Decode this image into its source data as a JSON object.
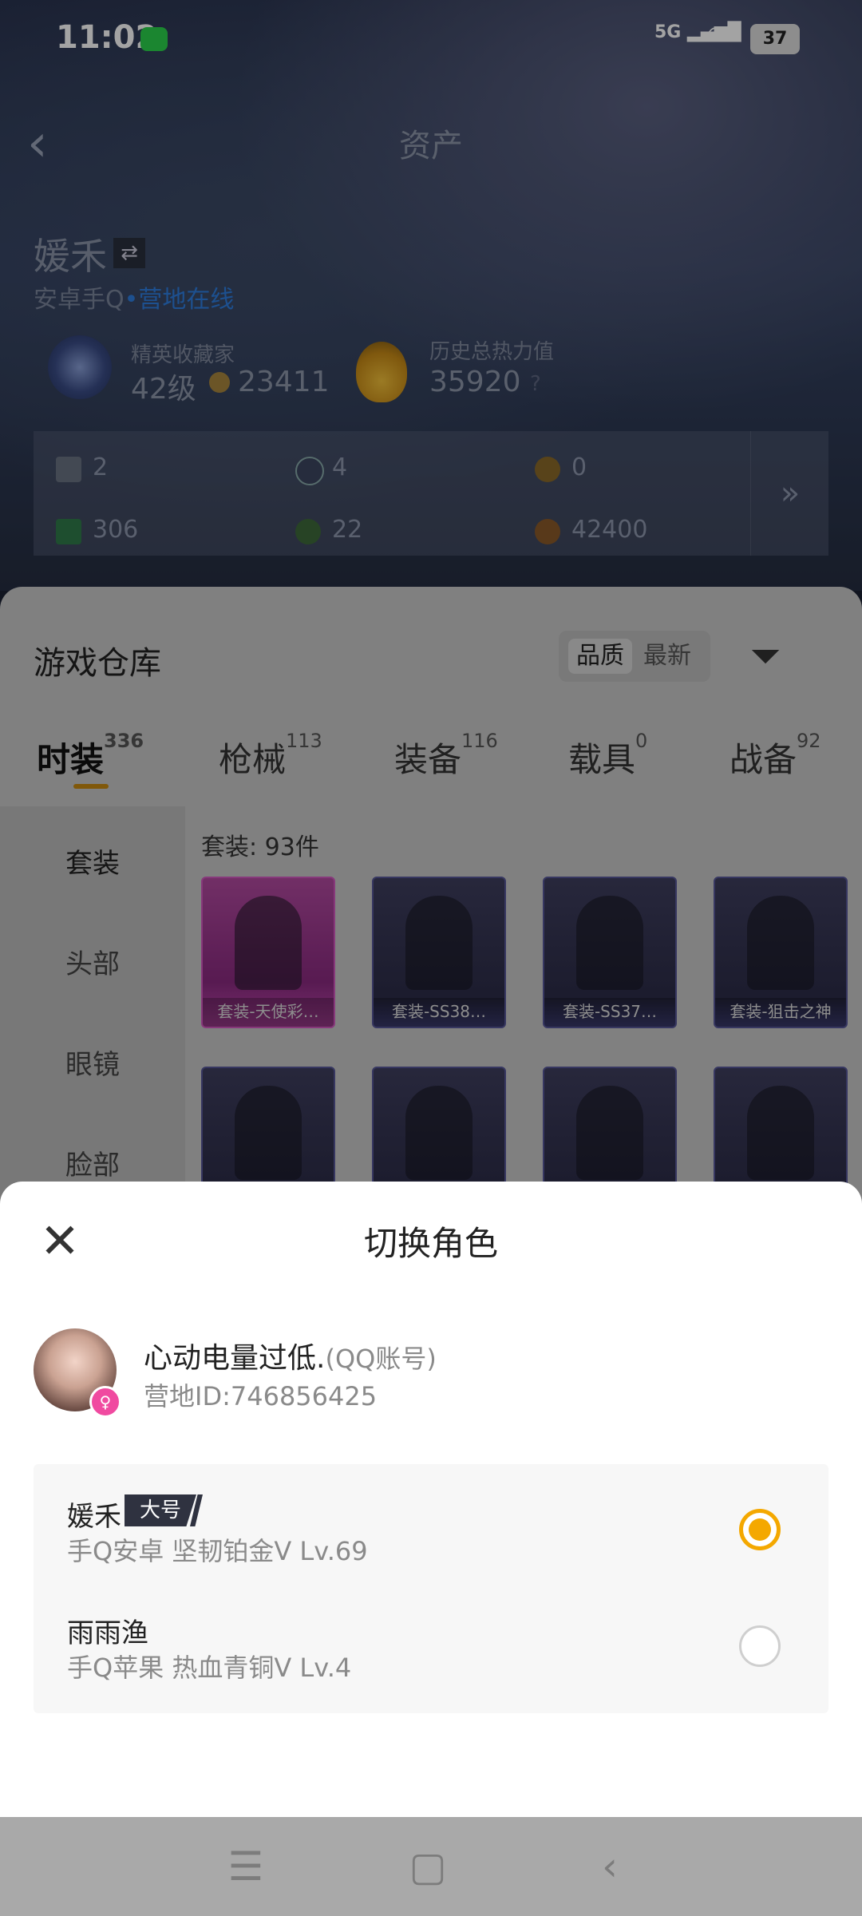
{
  "status_bar": {
    "time": "11:02",
    "network": "5G",
    "battery": "37"
  },
  "header": {
    "title": "资产"
  },
  "player": {
    "name": "媛禾",
    "platform": "安卓手Q",
    "online_status": "营地在线",
    "rank_title": "精英收藏家",
    "level": "42级",
    "coins": "23411",
    "heat_label": "历史总热力值",
    "heat_value": "35920",
    "heat_help": "?"
  },
  "assets": [
    {
      "icon": "card-icon",
      "value": "2"
    },
    {
      "icon": "s-coin-icon",
      "value": "4"
    },
    {
      "icon": "a-coin-icon",
      "value": "0"
    },
    {
      "icon": "ticket-icon",
      "value": "306"
    },
    {
      "icon": "gem-icon",
      "value": "22"
    },
    {
      "icon": "bronze-coin-icon",
      "value": "42400"
    }
  ],
  "warehouse": {
    "title": "游戏仓库",
    "sort": {
      "quality": "品质",
      "newest": "最新"
    },
    "tabs": [
      {
        "label": "时装",
        "count": "336"
      },
      {
        "label": "枪械",
        "count": "113"
      },
      {
        "label": "装备",
        "count": "116"
      },
      {
        "label": "载具",
        "count": "0"
      },
      {
        "label": "战备",
        "count": "92"
      }
    ],
    "side_nav": [
      "套装",
      "头部",
      "眼镜",
      "脸部"
    ],
    "count_label": "套装: 93件",
    "items": [
      {
        "caption": "套装-天使彩…"
      },
      {
        "caption": "套装-SS38…"
      },
      {
        "caption": "套装-SS37…"
      },
      {
        "caption": "套装-狙击之神"
      },
      {
        "caption": ""
      },
      {
        "caption": ""
      },
      {
        "caption": ""
      },
      {
        "caption": ""
      }
    ]
  },
  "sheet": {
    "title": "切换角色",
    "account": {
      "name": "心动电量过低.",
      "type": "(QQ账号)",
      "id": "营地ID:746856425"
    },
    "roles": [
      {
        "name": "媛禾",
        "tag": "大号",
        "info": "手Q安卓   坚韧铂金V   Lv.69",
        "selected": true
      },
      {
        "name": "雨雨渔",
        "tag": "",
        "info": "手Q苹果   热血青铜V   Lv.4",
        "selected": false
      }
    ]
  },
  "colors": {
    "accent": "#f4a800",
    "online": "#2e7de0",
    "tab_underline": "#c98a10"
  }
}
